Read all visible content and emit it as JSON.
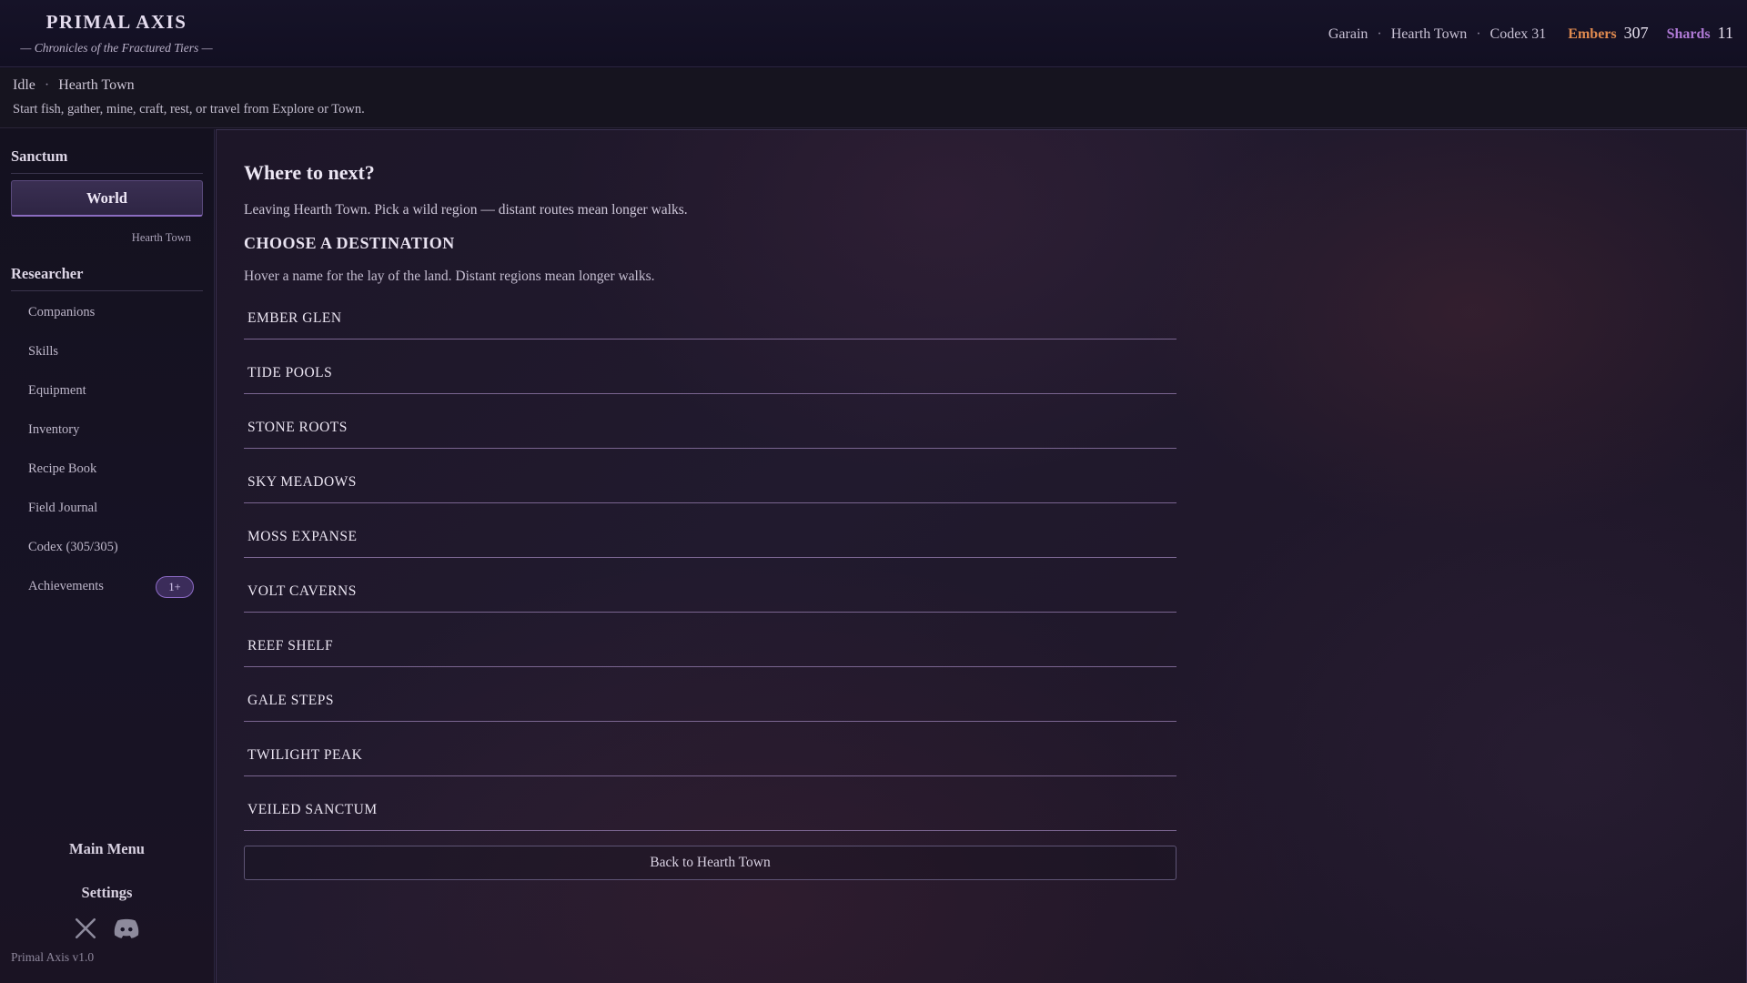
{
  "header": {
    "title": "PRIMAL AXIS",
    "subtitle": "— Chronicles of the Fractured Tiers —",
    "player": "Garain",
    "location": "Hearth Town",
    "codex": "Codex 31",
    "embers_label": "Embers",
    "embers_value": "307",
    "shards_label": "Shards",
    "shards_value": "11",
    "colors": {
      "embers": "#e08a4f",
      "shards": "#b07ad6"
    }
  },
  "activity": {
    "state": "Idle",
    "location": "Hearth Town",
    "hint": "Start fish, gather, mine, craft, rest, or travel from Explore or Town."
  },
  "sidebar": {
    "sanctum_heading": "Sanctum",
    "world_button": "World",
    "world_location": "Hearth Town",
    "researcher_heading": "Researcher",
    "items": [
      {
        "label": "Companions"
      },
      {
        "label": "Skills"
      },
      {
        "label": "Equipment"
      },
      {
        "label": "Inventory"
      },
      {
        "label": "Recipe Book"
      },
      {
        "label": "Field Journal"
      },
      {
        "label": "Codex (305/305)"
      },
      {
        "label": "Achievements",
        "badge": "1+"
      }
    ],
    "main_menu": "Main Menu",
    "settings": "Settings",
    "social": [
      "x-icon",
      "discord-icon"
    ],
    "version": "Primal Axis  v1.0"
  },
  "main": {
    "title": "Where to next?",
    "description": "Leaving Hearth Town. Pick a wild region — distant routes mean longer walks.",
    "choose_heading": "CHOOSE A DESTINATION",
    "hint": "Hover a name for the lay of the land. Distant regions mean longer walks.",
    "destinations": [
      "EMBER GLEN",
      "TIDE POOLS",
      "STONE ROOTS",
      "SKY MEADOWS",
      "MOSS EXPANSE",
      "VOLT CAVERNS",
      "REEF SHELF",
      "GALE STEPS",
      "TWILIGHT PEAK",
      "VEILED SANCTUM"
    ],
    "back_button": "Back to Hearth Town"
  }
}
